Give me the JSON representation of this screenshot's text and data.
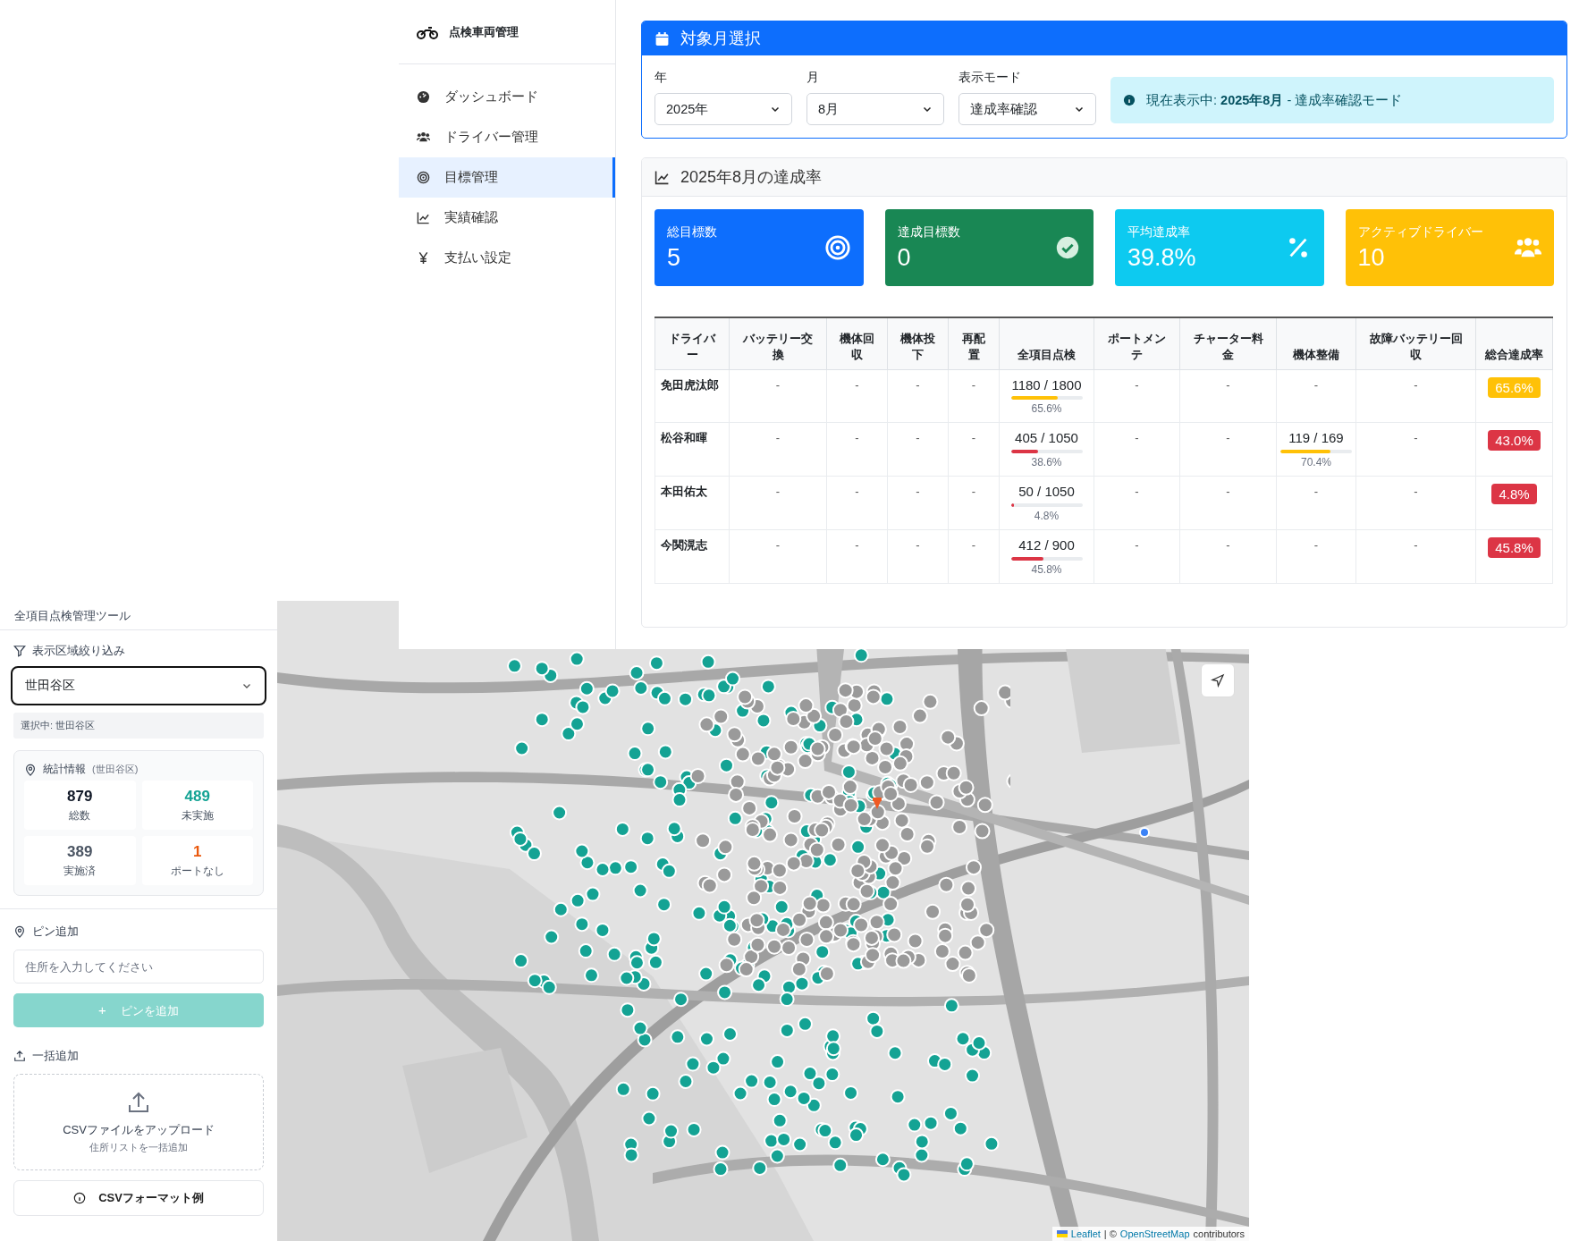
{
  "sidebar": {
    "brand": "点検車両管理",
    "items": [
      {
        "label": "ダッシュボード",
        "selected": false
      },
      {
        "label": "ドライバー管理",
        "selected": false
      },
      {
        "label": "目標管理",
        "selected": true
      },
      {
        "label": "実績確認",
        "selected": false
      },
      {
        "label": "支払い設定",
        "selected": false
      }
    ]
  },
  "month_selector": {
    "title": "対象月選択",
    "fields": [
      {
        "label": "年",
        "value": "2025年"
      },
      {
        "label": "月",
        "value": "8月"
      },
      {
        "label": "表示モード",
        "value": "達成率確認"
      }
    ],
    "notice": "現在表示中: **2025年8月** - 達成率確認モード"
  },
  "achievement": {
    "title": "2025年8月の達成率",
    "stats": [
      {
        "label": "総目標数",
        "value": "5",
        "color": "#0d6efd"
      },
      {
        "label": "達成目標数",
        "value": "0",
        "color": "#198754"
      },
      {
        "label": "平均達成率",
        "value": "39.8%",
        "color": "#0dcaf0"
      },
      {
        "label": "アクティブドライバー",
        "value": "10",
        "color": "#ffc107"
      }
    ],
    "table": {
      "columns": [
        "ドライバー",
        "バッテリー交換",
        "機体回収",
        "機体投下",
        "再配置",
        "全項目点検",
        "ポートメンテ",
        "チャーター料金",
        "機体整備",
        "故障バッテリー回収",
        "総合達成率"
      ],
      "rows": [
        {
          "cells": [
            {
              "kind": "name",
              "text": "免田虎汰郎"
            },
            {
              "kind": "empty",
              "text": "-"
            },
            {
              "kind": "empty",
              "text": "-"
            },
            {
              "kind": "empty",
              "text": "-"
            },
            {
              "kind": "empty",
              "text": "-"
            },
            {
              "kind": "progress",
              "text": "1180 / 1800",
              "level": 0.656,
              "percent": "65.6%",
              "color": "#ffc107"
            },
            {
              "kind": "empty",
              "text": "-"
            },
            {
              "kind": "empty",
              "text": "-"
            },
            {
              "kind": "empty",
              "text": "-"
            },
            {
              "kind": "empty",
              "text": "-"
            },
            {
              "kind": "badge",
              "text": "65.6%",
              "color": "#ffc107"
            }
          ]
        },
        {
          "cells": [
            {
              "kind": "name",
              "text": "松谷和暉"
            },
            {
              "kind": "empty",
              "text": "-"
            },
            {
              "kind": "empty",
              "text": "-"
            },
            {
              "kind": "empty",
              "text": "-"
            },
            {
              "kind": "empty",
              "text": "-"
            },
            {
              "kind": "progress",
              "text": "405 / 1050",
              "level": 0.386,
              "percent": "38.6%",
              "color": "#dc3545"
            },
            {
              "kind": "empty",
              "text": "-"
            },
            {
              "kind": "empty",
              "text": "-"
            },
            {
              "kind": "progress",
              "text": "119 / 169",
              "level": 0.704,
              "percent": "70.4%",
              "color": "#ffc107"
            },
            {
              "kind": "empty",
              "text": "-"
            },
            {
              "kind": "badge",
              "text": "43.0%",
              "color": "#dc3545"
            }
          ]
        },
        {
          "cells": [
            {
              "kind": "name",
              "text": "本田佑太"
            },
            {
              "kind": "empty",
              "text": "-"
            },
            {
              "kind": "empty",
              "text": "-"
            },
            {
              "kind": "empty",
              "text": "-"
            },
            {
              "kind": "empty",
              "text": "-"
            },
            {
              "kind": "progress",
              "text": "50 / 1050",
              "level": 0.048,
              "percent": "4.8%",
              "color": "#dc3545"
            },
            {
              "kind": "empty",
              "text": "-"
            },
            {
              "kind": "empty",
              "text": "-"
            },
            {
              "kind": "empty",
              "text": "-"
            },
            {
              "kind": "empty",
              "text": "-"
            },
            {
              "kind": "badge",
              "text": "4.8%",
              "color": "#dc3545"
            }
          ]
        },
        {
          "cells": [
            {
              "kind": "name",
              "text": "今関滉志"
            },
            {
              "kind": "empty",
              "text": "-"
            },
            {
              "kind": "empty",
              "text": "-"
            },
            {
              "kind": "empty",
              "text": "-"
            },
            {
              "kind": "empty",
              "text": "-"
            },
            {
              "kind": "progress",
              "text": "412 / 900",
              "level": 0.458,
              "percent": "45.8%",
              "color": "#dc3545"
            },
            {
              "kind": "empty",
              "text": "-"
            },
            {
              "kind": "empty",
              "text": "-"
            },
            {
              "kind": "empty",
              "text": "-"
            },
            {
              "kind": "empty",
              "text": "-"
            },
            {
              "kind": "badge",
              "text": "45.8%",
              "color": "#dc3545"
            }
          ]
        }
      ]
    }
  },
  "tool_panel": {
    "title": "全項目点検管理ツール",
    "filter": {
      "label": "表示区域絞り込み",
      "value": "世田谷区",
      "selection": "選択中: 世田谷区"
    },
    "stats": {
      "title": "統計情報",
      "area": "(世田谷区)",
      "items": [
        {
          "value": "879",
          "label": "総数",
          "color": "#111827"
        },
        {
          "value": "489",
          "label": "未実施",
          "color": "#14a394"
        },
        {
          "value": "389",
          "label": "実施済",
          "color": "#4b5563"
        },
        {
          "value": "1",
          "label": "ポートなし",
          "color": "#ea580c"
        }
      ]
    },
    "pin": {
      "title": "ピン追加",
      "placeholder": "住所を入力してください",
      "button_icon": "+",
      "button": "ピンを追加",
      "disabled": true
    },
    "bulk": {
      "title": "一括追加",
      "upload_title": "CSVファイルをアップロード",
      "upload_hint": "住所リストを一括追加",
      "format_button": "CSVフォーマット例"
    }
  },
  "map": {
    "kind": "picture",
    "attribution": [
      {
        "text": "Leaflet",
        "link": true
      },
      {
        "text": "| ©",
        "link": false
      },
      {
        "text": "OpenStreetMap",
        "link": true
      },
      {
        "text": "contributors",
        "link": false
      }
    ]
  }
}
